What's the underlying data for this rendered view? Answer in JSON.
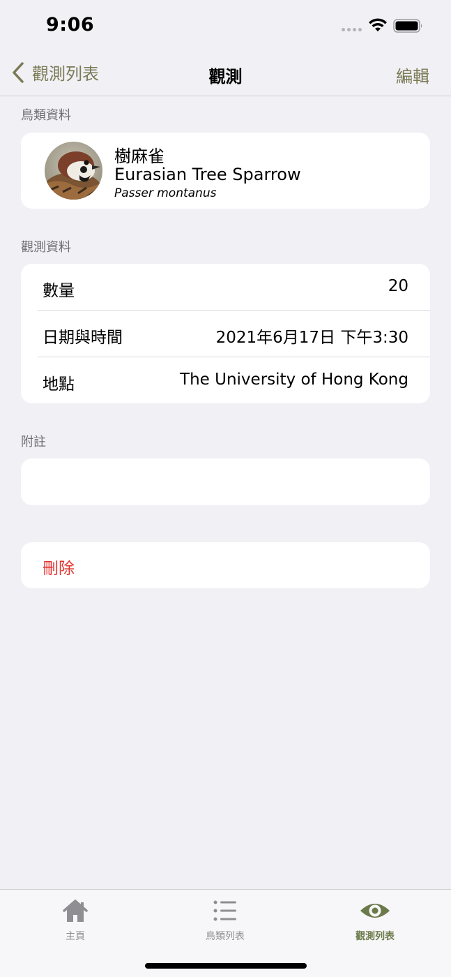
{
  "status_bar": {
    "time": "9:06"
  },
  "nav": {
    "back_label": "觀測列表",
    "title": "觀測",
    "edit_label": "編輯"
  },
  "bird_section": {
    "header": "鳥類資料",
    "name_zh": "樹麻雀",
    "name_en": "Eurasian Tree Sparrow",
    "name_sci": "Passer montanus"
  },
  "observation_section": {
    "header": "觀測資料",
    "rows": [
      {
        "label": "數量",
        "value": "20"
      },
      {
        "label": "日期與時間",
        "value": "2021年6月17日 下午3:30"
      },
      {
        "label": "地點",
        "value": "The University of Hong Kong"
      }
    ]
  },
  "notes_section": {
    "header": "附註",
    "value": ""
  },
  "delete_label": "刪除",
  "tabs": [
    {
      "label": "主頁",
      "icon": "house-icon",
      "active": false
    },
    {
      "label": "鳥類列表",
      "icon": "list-icon",
      "active": false
    },
    {
      "label": "觀測列表",
      "icon": "eye-icon",
      "active": true
    }
  ],
  "colors": {
    "accent": "#7a7a55",
    "destructive": "#e2332f",
    "background": "#f0f0f5",
    "tab_active": "#6b7a4a"
  }
}
